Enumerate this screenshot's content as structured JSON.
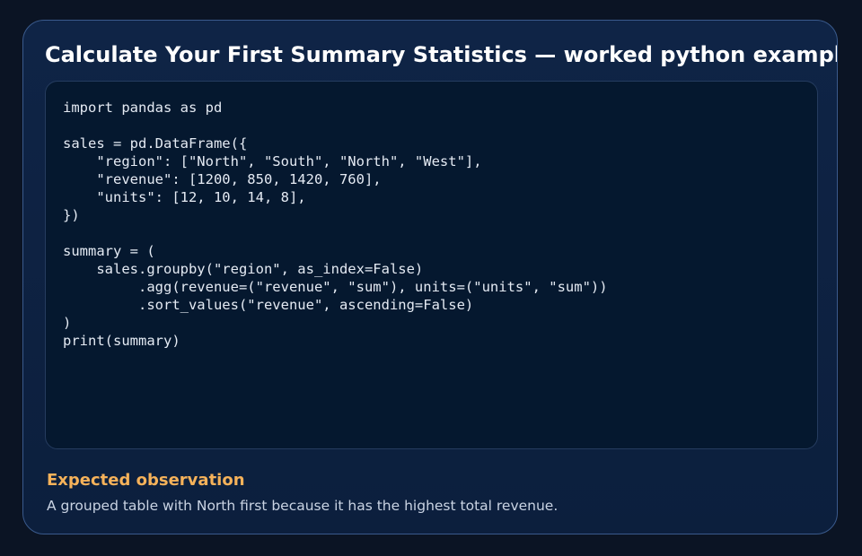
{
  "card": {
    "title": "Calculate Your First Summary Statistics — worked python example",
    "code": "import pandas as pd\n\nsales = pd.DataFrame({\n    \"region\": [\"North\", \"South\", \"North\", \"West\"],\n    \"revenue\": [1200, 850, 1420, 760],\n    \"units\": [12, 10, 14, 8],\n})\n\nsummary = (\n    sales.groupby(\"region\", as_index=False)\n         .agg(revenue=(\"revenue\", \"sum\"), units=(\"units\", \"sum\"))\n         .sort_values(\"revenue\", ascending=False)\n)\nprint(summary)",
    "observation": {
      "heading": "Expected observation",
      "text": "A grouped table with North first because it has the highest total revenue."
    }
  },
  "colors": {
    "page_background": "#0b1424",
    "card_background": "#0f2446",
    "card_border": "#3a5a8c",
    "code_background": "#05182f",
    "title": "#ffffff",
    "code_text": "#e4eaf3",
    "observation_heading": "#f5b25a",
    "observation_text": "#c9d3e3"
  }
}
